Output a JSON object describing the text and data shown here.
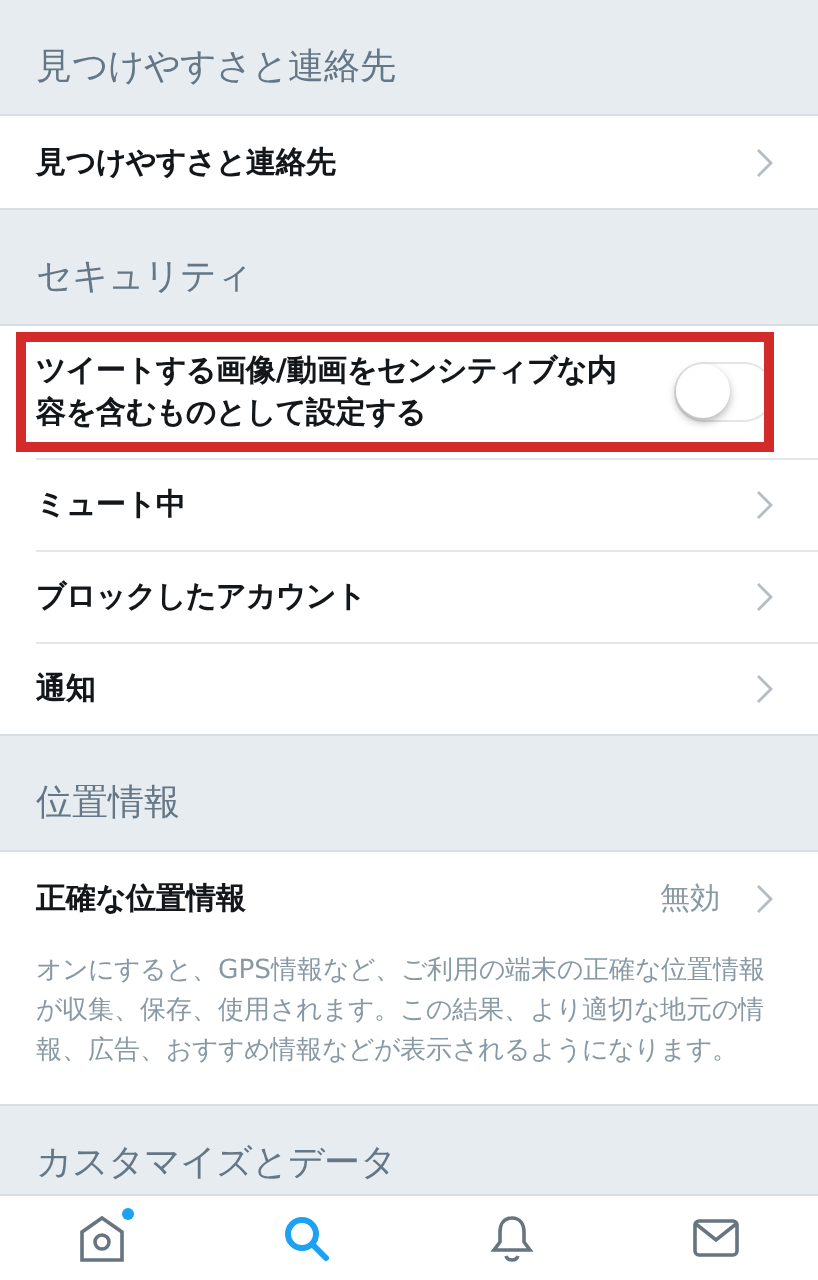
{
  "sections": [
    {
      "title": "見つけやすさと連絡先",
      "rows": [
        {
          "kind": "link",
          "label": "見つけやすさと連絡先"
        }
      ]
    },
    {
      "title": "セキュリティ",
      "rows": [
        {
          "kind": "toggle",
          "label": "ツイートする画像/動画をセンシティブな内容を含むものとして設定する",
          "on": false,
          "highlighted": true
        },
        {
          "kind": "link",
          "label": "ミュート中"
        },
        {
          "kind": "link",
          "label": "ブロックしたアカウント"
        },
        {
          "kind": "link",
          "label": "通知"
        }
      ]
    },
    {
      "title": "位置情報",
      "rows": [
        {
          "kind": "value",
          "label": "正確な位置情報",
          "value": "無効"
        }
      ],
      "note": "オンにすると、GPS情報など、ご利用の端末の正確な位置情報が収集、保存、使用されます。この結果、より適切な地元の情報、広告、おすすめ情報などが表示されるようになります。"
    },
    {
      "title": "カスタマイズとデータ"
    }
  ],
  "tabs": [
    {
      "kind": "home",
      "selected": false,
      "dot": true
    },
    {
      "kind": "search",
      "selected": true,
      "dot": false
    },
    {
      "kind": "bell",
      "selected": false,
      "dot": false
    },
    {
      "kind": "mail",
      "selected": false,
      "dot": false
    }
  ]
}
